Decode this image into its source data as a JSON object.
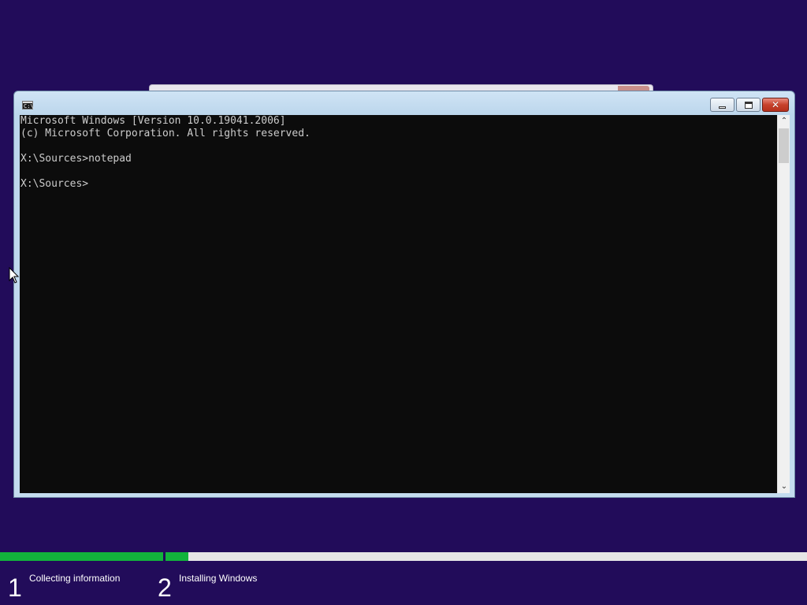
{
  "colors": {
    "desktop_background": "#220c5a",
    "console_background": "#0c0c0c",
    "console_text": "#cccccc",
    "progress_fill": "#12b33c",
    "progress_track": "#e6e6e6"
  },
  "console_window": {
    "icon": "cmd-icon",
    "icon_text": "C:\\",
    "buttons": {
      "minimize": "minimize-icon",
      "maximize": "maximize-icon",
      "close_glyph": "✕"
    },
    "lines": [
      "Microsoft Windows [Version 10.0.19041.2006]",
      "(c) Microsoft Corporation. All rights reserved.",
      "",
      "X:\\Sources>notepad",
      "",
      "X:\\Sources>"
    ],
    "scrollbar": {
      "up_glyph": "⌃",
      "down_glyph": "⌄"
    }
  },
  "setup_progress": {
    "steps": [
      {
        "number": "1",
        "label": "Collecting information",
        "progress": 1.0
      },
      {
        "number": "2",
        "label": "Installing Windows",
        "progress": 0.036
      }
    ]
  }
}
